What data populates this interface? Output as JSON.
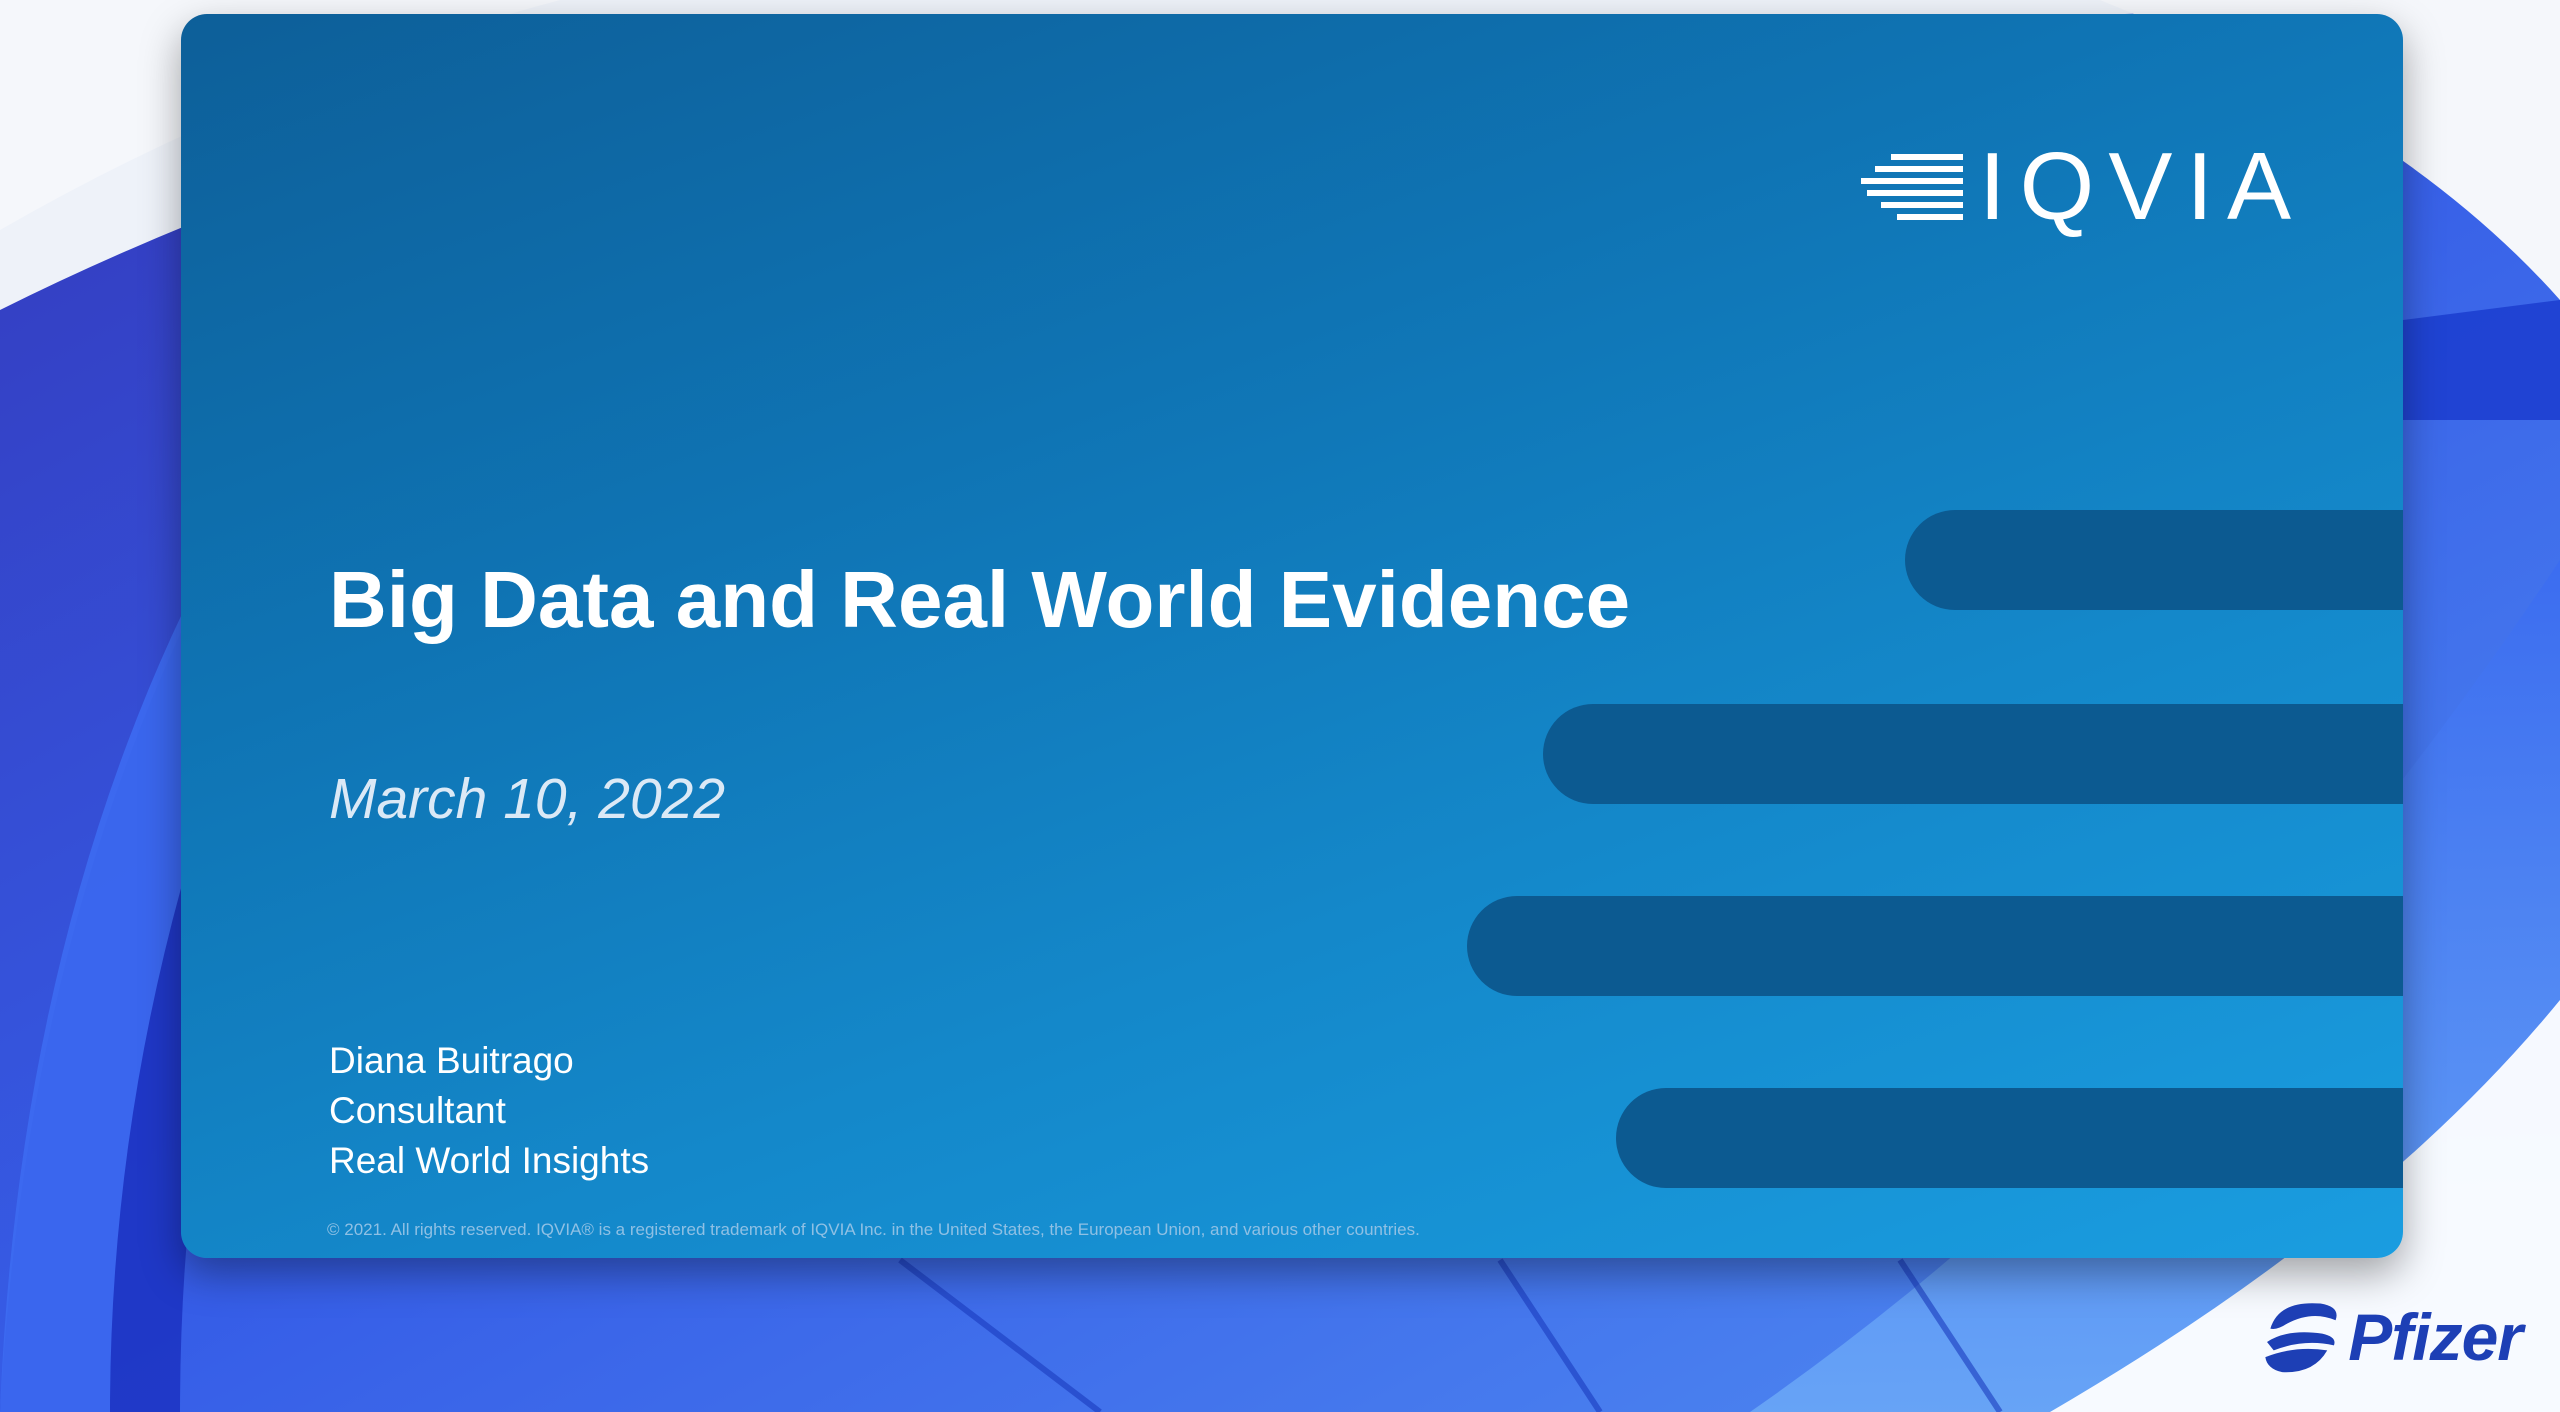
{
  "slide": {
    "title": "Big Data and Real World Evidence",
    "date": "March 10, 2022",
    "presenter": {
      "name": "Diana Buitrago",
      "role": "Consultant",
      "department": "Real World Insights"
    },
    "copyright": "© 2021. All rights reserved. IQVIA® is a registered trademark of IQVIA Inc. in the United States, the European Union, and various other countries.",
    "logo": {
      "text": "IQVIA",
      "icon": "iqvia-lines-icon"
    }
  },
  "sponsor": {
    "name": "Pfizer",
    "icon": "pfizer-swirl-icon"
  },
  "colors": {
    "slide_dark": "#0d5f99",
    "slide_light": "#1a9de0",
    "bar": "#0c5a91",
    "background_arcs": "#1f3fd6",
    "pfizer_blue": "#1d3fb5"
  }
}
